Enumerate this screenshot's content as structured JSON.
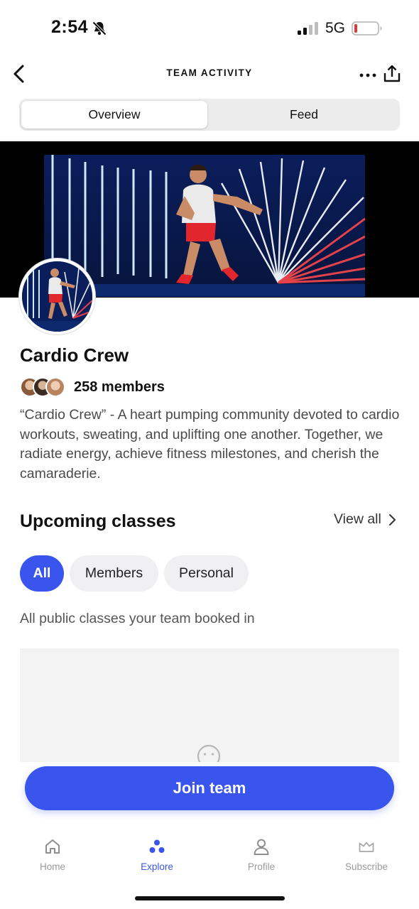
{
  "status_bar": {
    "time": "2:54",
    "network": "5G",
    "bell_icon": "bell-slash-icon",
    "signal_icon": "cellular-signal-icon",
    "battery_icon": "battery-low-icon",
    "battery_color": "#e03a3a"
  },
  "header": {
    "title": "TEAM ACTIVITY",
    "back_icon": "chevron-left-icon",
    "more_icon": "ellipsis-icon",
    "share_icon": "share-icon"
  },
  "tabs": [
    {
      "label": "Overview",
      "active": true
    },
    {
      "label": "Feed",
      "active": false
    }
  ],
  "team": {
    "name": "Cardio Crew",
    "members_label": "258 members",
    "description": "“Cardio Crew” - A heart pumping community devoted to cardio workouts, sweating, and uplifting one another. Together, we radiate energy, achieve fitness milestones, and cherish the camaraderie."
  },
  "upcoming": {
    "title": "Upcoming classes",
    "view_all": "View all",
    "filters": [
      {
        "label": "All",
        "active": true
      },
      {
        "label": "Members",
        "active": false
      },
      {
        "label": "Personal",
        "active": false
      }
    ],
    "hint": "All public classes your team booked in"
  },
  "join_button": "Join team",
  "bottom_nav": [
    {
      "label": "Home",
      "icon": "home-icon",
      "active": false
    },
    {
      "label": "Explore",
      "icon": "explore-dots-icon",
      "active": true
    },
    {
      "label": "Profile",
      "icon": "person-icon",
      "active": false
    },
    {
      "label": "Subscribe",
      "icon": "crown-icon",
      "active": false
    }
  ],
  "colors": {
    "accent": "#3a55ee",
    "inactive_nav": "#9a9a9a",
    "segment_bg": "#ececec"
  }
}
